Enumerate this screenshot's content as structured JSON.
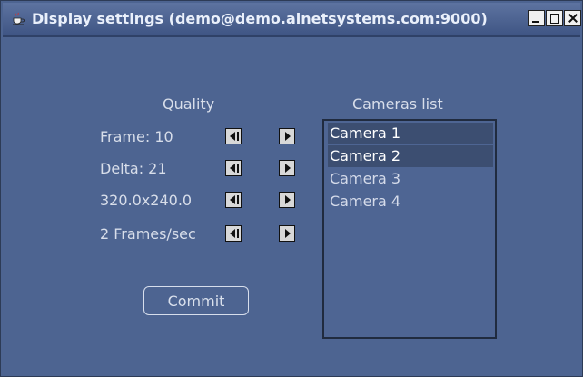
{
  "window": {
    "title": "Display settings (demo@demo.alnetsystems.com:9000)",
    "controls": {
      "minimize": "_",
      "maximize": "□",
      "close": "x"
    }
  },
  "quality": {
    "title": "Quality",
    "rows": [
      {
        "label": "Frame: 10"
      },
      {
        "label": "Delta: 21"
      },
      {
        "label": "320.0x240.0"
      },
      {
        "label": "2 Frames/sec"
      }
    ]
  },
  "cameras": {
    "title": "Cameras list",
    "items": [
      {
        "label": "Camera 1",
        "selected": true
      },
      {
        "label": "Camera 2",
        "selected": true
      },
      {
        "label": "Camera 3",
        "selected": false
      },
      {
        "label": "Camera 4",
        "selected": false
      }
    ]
  },
  "actions": {
    "commit_label": "Commit"
  },
  "colors": {
    "window_bg": "#4d6491",
    "titlebar_bg": "#3f5584",
    "selected_bg": "#3c4e71"
  }
}
